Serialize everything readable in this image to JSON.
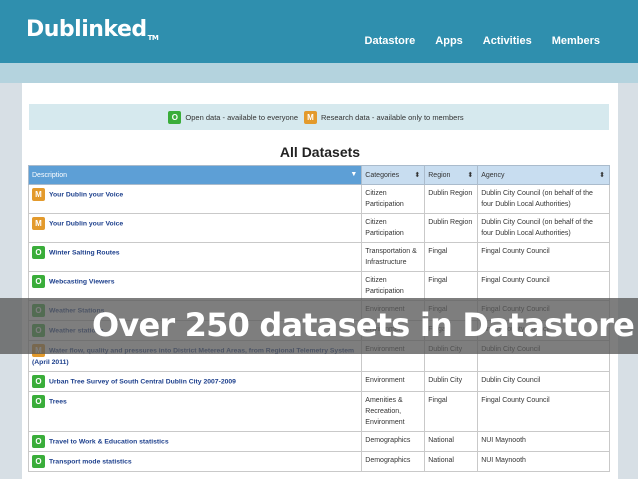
{
  "header": {
    "logo": "Dublinked",
    "logo_tm": "TM",
    "nav": [
      "Datastore",
      "Apps",
      "Activities",
      "Members"
    ]
  },
  "legend": {
    "open_badge": "O",
    "open_text": "Open data - available to everyone",
    "research_badge": "M",
    "research_text": "Research data - available only to members"
  },
  "title": "All Datasets",
  "table": {
    "headers": [
      "Description",
      "Categories",
      "Region",
      "Agency"
    ],
    "rows": [
      {
        "badge": "M",
        "desc": "Your Dublin your Voice",
        "cat": "Citizen Participation",
        "region": "Dublin Region",
        "agency": "Dublin City Council (on behalf of the four Dublin Local Authorities)"
      },
      {
        "badge": "M",
        "desc": "Your Dublin your Voice",
        "cat": "Citizen Participation",
        "region": "Dublin Region",
        "agency": "Dublin City Council (on behalf of the four Dublin Local Authorities)"
      },
      {
        "badge": "O",
        "desc": "Winter Salting Routes",
        "cat": "Transportation & Infrastructure",
        "region": "Fingal",
        "agency": "Fingal County Council"
      },
      {
        "badge": "O",
        "desc": "Webcasting Viewers",
        "cat": "Citizen Participation",
        "region": "Fingal",
        "agency": "Fingal County Council"
      },
      {
        "badge": "O",
        "desc": "Weather Stations",
        "cat": "Environment",
        "region": "Fingal",
        "agency": "Fingal County Council"
      },
      {
        "badge": "O",
        "desc": "Weather stations",
        "cat": "Environment",
        "region": "Fingal",
        "agency": "Fingal County Council"
      },
      {
        "badge": "M",
        "desc": "Water flow, quality and pressures into District Metered Areas, from Regional Telemetry System (April 2011)",
        "cat": "Environment",
        "region": "Dublin City",
        "agency": "Dublin City Council"
      },
      {
        "badge": "O",
        "desc": "Urban Tree Survey of South Central Dublin City 2007-2009",
        "cat": "Environment",
        "region": "Dublin City",
        "agency": "Dublin City Council"
      },
      {
        "badge": "O",
        "desc": "Trees",
        "cat": "Amenities & Recreation, Environment",
        "region": "Fingal",
        "agency": "Fingal County Council"
      },
      {
        "badge": "O",
        "desc": "Travel to Work & Education statistics",
        "cat": "Demographics",
        "region": "National",
        "agency": "NUI Maynooth"
      },
      {
        "badge": "O",
        "desc": "Transport mode statistics",
        "cat": "Demographics",
        "region": "National",
        "agency": "NUI Maynooth"
      }
    ]
  },
  "overlay_text": "Over 250 datasets in Datastore"
}
